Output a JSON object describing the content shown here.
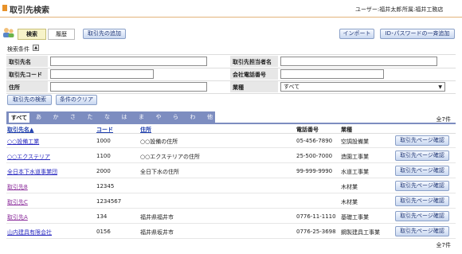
{
  "header": {
    "title": "取引先検索",
    "user": "ユーザー:福井太郎",
    "dept": "所属:福井工務店"
  },
  "toolbar": {
    "tab_search": "検索",
    "tab_history": "履歴",
    "add_partner": "取引先の追加",
    "import": "インポート",
    "bulk_id_password": "ID･パスワードの一斉追加"
  },
  "conditions": {
    "label": "検索条件",
    "toggle": "▲",
    "name_label": "取引先名",
    "code_label": "取引先コード",
    "address_label": "住所",
    "contact_label": "取引先担当者名",
    "phone_label": "会社電話番号",
    "industry_label": "業種",
    "industry_value": "すべて",
    "name_value": "",
    "code_value": "",
    "address_value": "",
    "contact_value": "",
    "phone_value": "",
    "search_button": "取引先の検索",
    "clear_button": "条件のクリア"
  },
  "kana_tabs": [
    "すべて",
    "あ",
    "か",
    "さ",
    "た",
    "な",
    "は",
    "ま",
    "や",
    "ら",
    "わ",
    "他"
  ],
  "result_count": "全7件",
  "columns": {
    "name": "取引先名▲",
    "code": "コード",
    "address": "住所",
    "phone": "電話番号",
    "industry": "業種"
  },
  "row_button": "取引先ページ確認",
  "rows": [
    {
      "name": "○○設備工業",
      "code": "1000",
      "address": "○○設備の住所",
      "phone": "05-456-7890",
      "industry": "空調設備業"
    },
    {
      "name": "○○エクステリア",
      "code": "1100",
      "address": "○○エクステリアの住所",
      "phone": "25-500-7000",
      "industry": "造園工事業"
    },
    {
      "name": "全日本下水道事業団",
      "code": "2000",
      "address": "全日下水の住所",
      "phone": "99-999-9990",
      "industry": "水道工事業"
    },
    {
      "name": "取引先B",
      "code": "12345",
      "address": "",
      "phone": "",
      "industry": "木材業"
    },
    {
      "name": "取引先C",
      "code": "1234567",
      "address": "",
      "phone": "",
      "industry": "木材業"
    },
    {
      "name": "取引先A",
      "code": "134",
      "address": "福井県福井市",
      "phone": "0776-11-1110",
      "industry": "基礎工事業"
    },
    {
      "name": "山内建具有限会社",
      "code": "0156",
      "address": "福井県坂井市",
      "phone": "0776-25-3698",
      "industry": "鋼製建具工事業"
    }
  ],
  "colors": {
    "accent": "#e8922a",
    "tab_active": "#f7f3c9",
    "kana_bar": "#7d8dc0",
    "link": "#2a2ac0",
    "visited": "#8a2a9a"
  }
}
